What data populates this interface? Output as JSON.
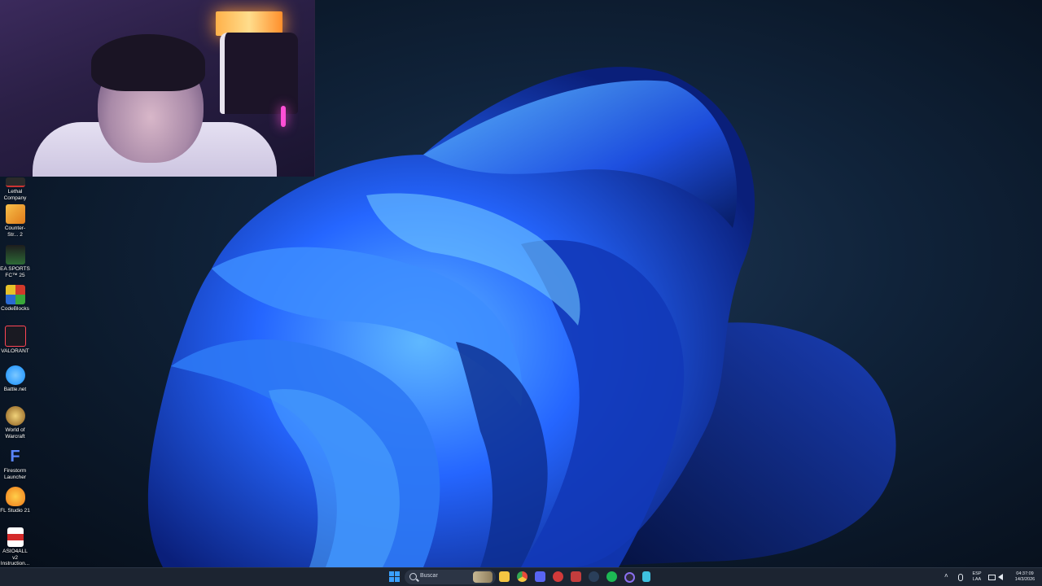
{
  "desktop_icons": [
    {
      "label": "Lethal Company",
      "icon": "lethal-company-icon",
      "color": "#2a2a2a"
    },
    {
      "label": "Counter-Str... 2",
      "icon": "counter-strike-icon",
      "color": "#f2a12a"
    },
    {
      "label": "EA SPORTS FC™ 25",
      "icon": "ea-sports-fc-icon",
      "color": "#1f4d2a"
    },
    {
      "label": "CodeBlocks",
      "icon": "codeblocks-icon",
      "color": "#d23a2a"
    },
    {
      "label": "VALORANT",
      "icon": "valorant-icon",
      "color": "#ff4655"
    },
    {
      "label": "Battle.net",
      "icon": "battlenet-icon",
      "color": "#148eff"
    },
    {
      "label": "World of Warcraft",
      "icon": "world-of-warcraft-icon",
      "color": "#c28f2c"
    },
    {
      "label": "Firestorm Launcher",
      "icon": "firestorm-icon",
      "color": "#3f6fe0"
    },
    {
      "label": "FL Studio 21",
      "icon": "fl-studio-icon",
      "color": "#f08a1a"
    },
    {
      "label": "ASIO4ALL v2 Instruction...",
      "icon": "pdf-icon",
      "color": "#d42a2a"
    }
  ],
  "taskbar": {
    "search_placeholder": "Buscar",
    "apps": [
      {
        "name": "file-explorer-icon",
        "color": "#f4c542"
      },
      {
        "name": "chrome-icon",
        "color": "#e84a3a"
      },
      {
        "name": "discord-icon",
        "color": "#5865f2"
      },
      {
        "name": "app-red-icon",
        "color": "#d23a3a"
      },
      {
        "name": "app-media-icon",
        "color": "#c33d3d"
      },
      {
        "name": "steam-icon",
        "color": "#1b2838"
      },
      {
        "name": "spotify-icon",
        "color": "#1db954"
      },
      {
        "name": "obs-icon",
        "color": "#6a4fcf"
      },
      {
        "name": "notepad-icon",
        "color": "#3fc1e0"
      }
    ],
    "language_top": "ESP",
    "language_bottom": "LAA",
    "time": "04:37:09",
    "date": "14/3/2026"
  }
}
